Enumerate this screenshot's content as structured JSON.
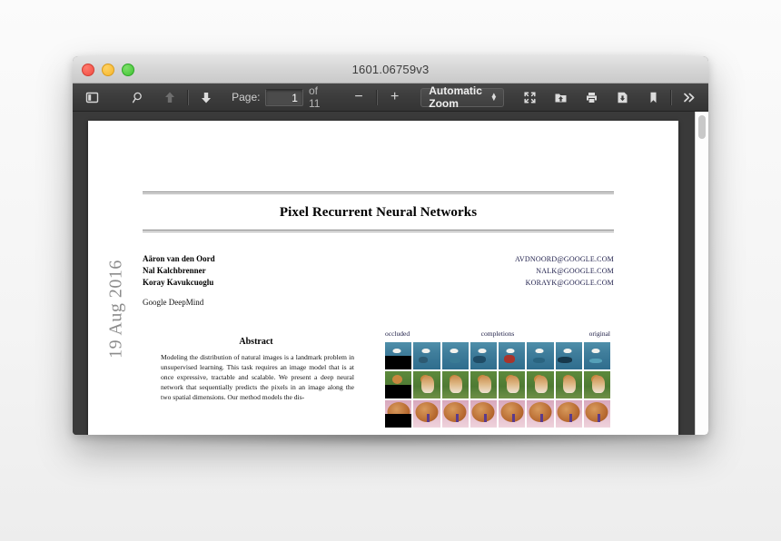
{
  "window": {
    "title": "1601.06759v3",
    "traffic_lights": [
      "close-red",
      "minimize-yellow",
      "maximize-green"
    ]
  },
  "toolbar": {
    "sidebar_toggle_icon": "sidebar-toggle-icon",
    "find_icon": "search-icon",
    "previous_page_icon": "arrow-up-icon",
    "next_page_icon": "arrow-down-icon",
    "page_label": "Page:",
    "page_value": "1",
    "page_of": "of 11",
    "zoom_out_label": "−",
    "zoom_in_label": "+",
    "zoom_select_value": "Automatic Zoom",
    "presentation_icon": "fullscreen-icon",
    "open_file_icon": "open-file-icon",
    "print_icon": "print-icon",
    "download_icon": "download-icon",
    "bookmark_icon": "bookmark-icon",
    "tools_icon": "double-chevron-right-icon"
  },
  "viewer": {
    "scrollbar": "vertical-scrollbar"
  },
  "document": {
    "arxiv_stamp": "19 Aug 2016",
    "title": "Pixel Recurrent Neural Networks",
    "authors": [
      "Aäron van den Oord",
      "Nal Kalchbrenner",
      "Koray Kavukcuoglu"
    ],
    "emails": [
      "AVDNOORD@GOOGLE.COM",
      "NALK@GOOGLE.COM",
      "KORAYK@GOOGLE.COM"
    ],
    "affiliation": "Google DeepMind",
    "abstract_heading": "Abstract",
    "abstract_text": "Modeling the distribution of natural images is a landmark problem in unsupervised learning. This task requires an image model that is at once expressive, tractable and scalable. We present a deep neural network that sequentially predicts the pixels in an image along the two spatial dimensions. Our method models the dis-",
    "figure": {
      "label_left": "occluded",
      "label_center": "completions",
      "label_right": "original",
      "columns": 8,
      "rows": 3,
      "row_subjects": [
        "ocean-bird",
        "dog-on-grass",
        "orange-disc-pink"
      ]
    }
  },
  "colors": {
    "titlebar": "#d4d4d4",
    "toolbar": "#3c3c3c",
    "viewer_bg": "#3a3a3a",
    "page_bg": "#ffffff",
    "desktop_bg": "#f7f7f7",
    "light_red": "#f04a41",
    "light_yellow": "#f5b62c",
    "light_green": "#3fc232"
  }
}
